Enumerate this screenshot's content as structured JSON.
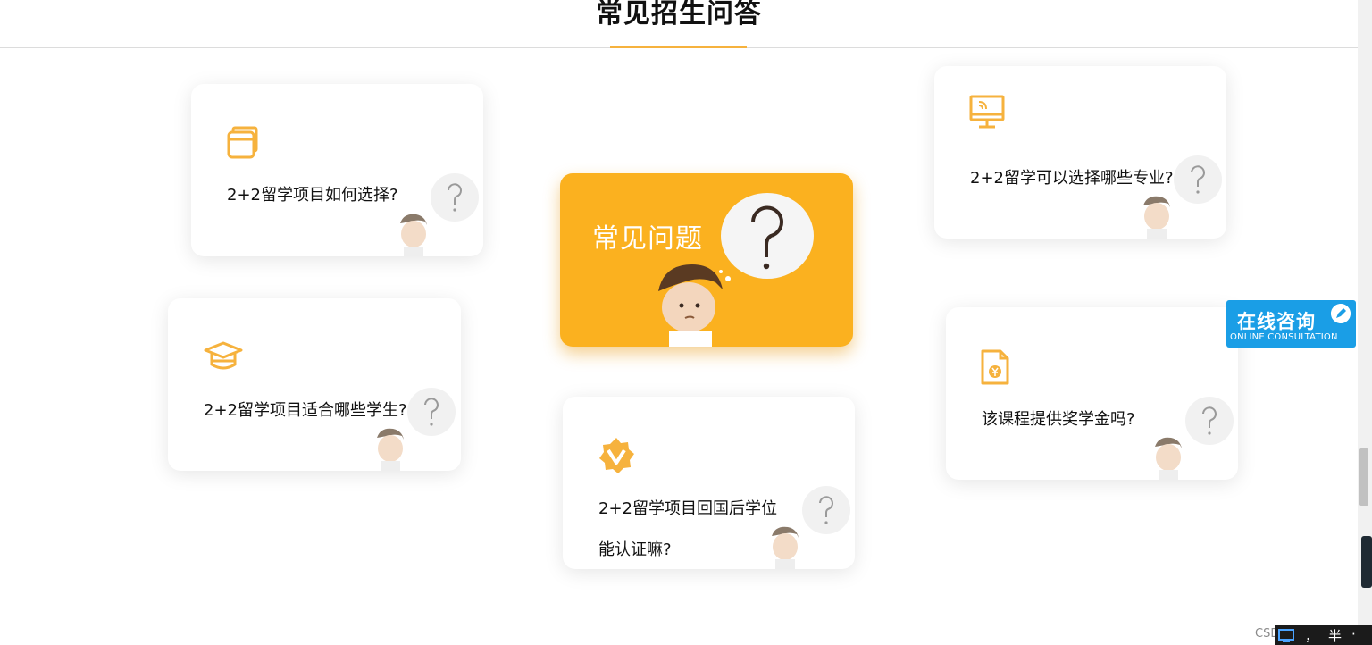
{
  "page": {
    "title": "常见招生问答",
    "accent": "#f6b23d"
  },
  "center_card": {
    "label": "常见问题",
    "color": "#fbb11f"
  },
  "faq": [
    {
      "question": "2+2留学项目如何选择?",
      "icon": "cards-icon"
    },
    {
      "question": "2+2留学项目适合哪些学生?",
      "icon": "graduation-cap-icon"
    },
    {
      "question_line1": "2+2留学项目回国后学位",
      "question_line2": "能认证嘛?",
      "icon": "badge-v-icon"
    },
    {
      "question": "2+2留学可以选择哪些专业?",
      "icon": "monitor-icon"
    },
    {
      "question": "该课程提供奖学金吗?",
      "icon": "document-yen-icon"
    }
  ],
  "side_widget": {
    "title": "在线咨询",
    "subtitle": "ONLINE CONSULTATION",
    "color": "#1a9ee6"
  },
  "footer": {
    "watermark": "CSDN @H_~半"
  },
  "ime_bar": {
    "item1": "，",
    "item2": "半",
    "item3": "·"
  }
}
